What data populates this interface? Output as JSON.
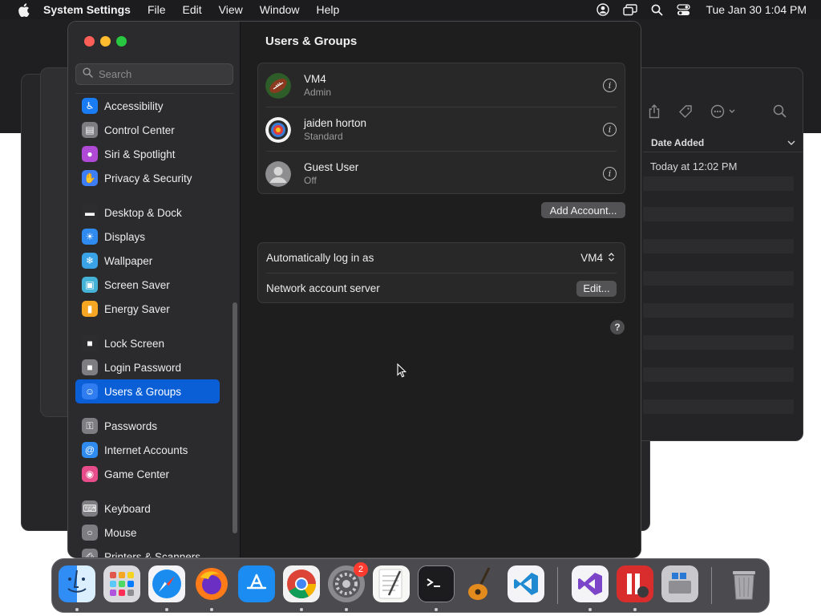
{
  "menubar": {
    "app_name": "System Settings",
    "menus": [
      "File",
      "Edit",
      "View",
      "Window",
      "Help"
    ],
    "clock": "Tue Jan 30  1:04 PM"
  },
  "background_window": {
    "column_header": "Date Added",
    "date_value": "Today at 12:02 PM"
  },
  "sidebar": {
    "search_placeholder": "Search",
    "groups": [
      [
        {
          "label": "Accessibility",
          "icon": "accessibility-icon",
          "color": "#1a7cf5"
        },
        {
          "label": "Control Center",
          "icon": "control-center-icon",
          "color": "#7d7d82"
        },
        {
          "label": "Siri & Spotlight",
          "icon": "siri-icon",
          "color": "#b04ad6"
        },
        {
          "label": "Privacy & Security",
          "icon": "hand-icon",
          "color": "#3d7df5"
        }
      ],
      [
        {
          "label": "Desktop & Dock",
          "icon": "dock-icon",
          "color": "#2d2d30"
        },
        {
          "label": "Displays",
          "icon": "sun-icon",
          "color": "#2f8bf0"
        },
        {
          "label": "Wallpaper",
          "icon": "wallpaper-icon",
          "color": "#3aa3e8"
        },
        {
          "label": "Screen Saver",
          "icon": "screen-saver-icon",
          "color": "#45b3d8"
        },
        {
          "label": "Energy Saver",
          "icon": "battery-icon",
          "color": "#f5a623"
        }
      ],
      [
        {
          "label": "Lock Screen",
          "icon": "lock-icon",
          "color": "#2d2d30"
        },
        {
          "label": "Login Password",
          "icon": "login-lock-icon",
          "color": "#7d7d82"
        },
        {
          "label": "Users & Groups",
          "icon": "users-icon",
          "color": "#2f7df0",
          "selected": true
        }
      ],
      [
        {
          "label": "Passwords",
          "icon": "key-icon",
          "color": "#7d7d82"
        },
        {
          "label": "Internet Accounts",
          "icon": "at-icon",
          "color": "#2f8bf0"
        },
        {
          "label": "Game Center",
          "icon": "game-center-icon",
          "color": "#e84c8a"
        }
      ],
      [
        {
          "label": "Keyboard",
          "icon": "keyboard-icon",
          "color": "#7d7d82"
        },
        {
          "label": "Mouse",
          "icon": "mouse-icon",
          "color": "#7d7d82"
        },
        {
          "label": "Printers & Scanners",
          "icon": "printer-icon",
          "color": "#7d7d82"
        }
      ]
    ]
  },
  "content": {
    "title": "Users & Groups",
    "users": [
      {
        "name": "VM4",
        "role": "Admin",
        "avatar": "football-avatar"
      },
      {
        "name": "jaiden horton",
        "role": "Standard",
        "avatar": "target-avatar"
      },
      {
        "name": "Guest User",
        "role": "Off",
        "avatar": "guest-avatar"
      }
    ],
    "info_glyph": "i",
    "add_account_label": "Add Account...",
    "auto_login_label": "Automatically log in as",
    "auto_login_value": "VM4",
    "network_server_label": "Network account server",
    "edit_label": "Edit...",
    "help_glyph": "?"
  },
  "dock": {
    "apps": [
      {
        "name": "Finder",
        "icon": "finder-icon",
        "running": true
      },
      {
        "name": "Launchpad",
        "icon": "launchpad-icon",
        "running": false
      },
      {
        "name": "Safari",
        "icon": "safari-icon",
        "running": true
      },
      {
        "name": "Firefox",
        "icon": "firefox-icon",
        "running": true
      },
      {
        "name": "App Store",
        "icon": "app-store-icon",
        "running": false
      },
      {
        "name": "Chrome",
        "icon": "chrome-icon",
        "running": true
      },
      {
        "name": "System Settings",
        "icon": "system-settings-icon",
        "running": true,
        "badge": "2"
      },
      {
        "name": "TextEdit",
        "icon": "textedit-icon",
        "running": false
      },
      {
        "name": "Terminal",
        "icon": "terminal-icon",
        "running": true
      },
      {
        "name": "GarageBand",
        "icon": "garageband-icon",
        "running": false
      },
      {
        "name": "Visual Studio Code",
        "icon": "vscode-icon",
        "running": false
      },
      {
        "name": "Visual Studio",
        "icon": "visual-studio-icon",
        "running": true
      },
      {
        "name": "Parallels",
        "icon": "parallels-icon",
        "running": true
      },
      {
        "name": "Boot Camp Assistant",
        "icon": "bootcamp-icon",
        "running": false
      },
      {
        "name": "Trash",
        "icon": "trash-icon",
        "running": false
      }
    ]
  }
}
